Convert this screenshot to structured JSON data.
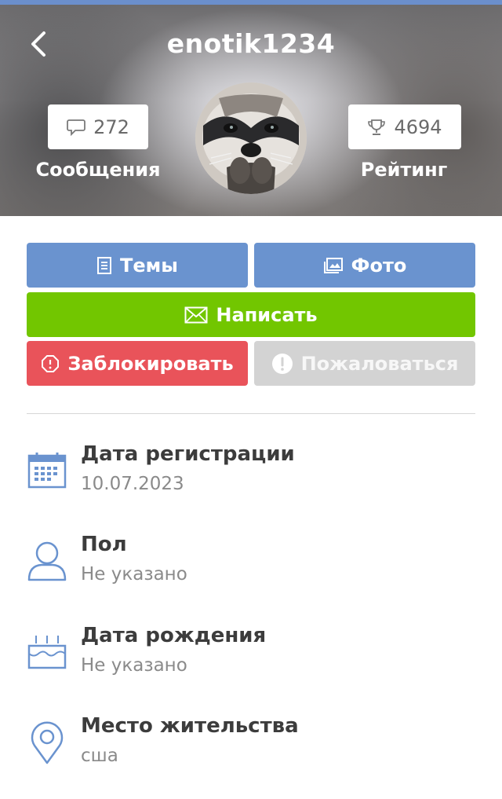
{
  "colors": {
    "accent_blue": "#6a93cf",
    "green": "#72c600",
    "red": "#e9535a",
    "gray_button": "#d3d3d3",
    "icon_blue": "#6a93cf"
  },
  "header": {
    "username": "enotik1234",
    "back_icon": "chevron-left-icon",
    "messages": {
      "icon": "chat-bubble-icon",
      "count": "272",
      "label": "Сообщения"
    },
    "rating": {
      "icon": "trophy-icon",
      "count": "4694",
      "label": "Рейтинг"
    },
    "avatar": "raccoon-avatar"
  },
  "actions": {
    "themes": {
      "icon": "document-icon",
      "label": "Темы"
    },
    "photo": {
      "icon": "images-icon",
      "label": "Фото"
    },
    "write": {
      "icon": "envelope-icon",
      "label": "Написать"
    },
    "block": {
      "icon": "octagon-warning-icon",
      "label": "Заблокировать"
    },
    "report": {
      "icon": "exclamation-circle-icon",
      "label": "Пожаловаться"
    }
  },
  "info": [
    {
      "icon": "calendar-icon",
      "title": "Дата регистрации",
      "value": "10.07.2023"
    },
    {
      "icon": "user-icon",
      "title": "Пол",
      "value": "Не указано"
    },
    {
      "icon": "birthday-cake-icon",
      "title": "Дата рождения",
      "value": "Не указано"
    },
    {
      "icon": "location-pin-icon",
      "title": "Место жительства",
      "value": "сша"
    }
  ]
}
